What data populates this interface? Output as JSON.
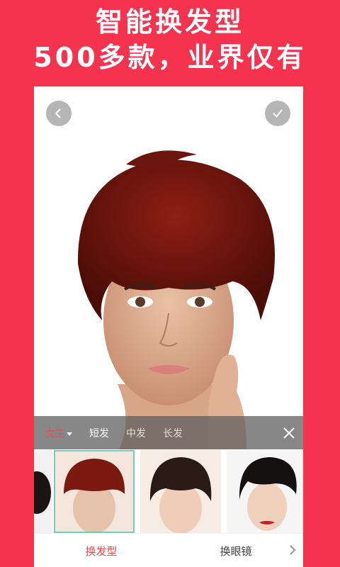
{
  "promo": {
    "line1": "智能换发型",
    "line2": "500多款，业界仅有"
  },
  "toolbar": {
    "back_icon": "chevron-left-icon",
    "confirm_icon": "check-icon"
  },
  "categories": {
    "gender": "女生",
    "items": [
      "短发",
      "中发",
      "长发"
    ],
    "close_icon": "close-icon"
  },
  "thumbnails": {
    "count": 4,
    "selected_index": 1
  },
  "bottom_nav": {
    "tabs": [
      "换发型",
      "换眼镜"
    ],
    "active": "换发型"
  },
  "colors": {
    "brand": "#f5334f",
    "active_text": "#f04a4a",
    "selected_outline": "#7ec8c4"
  }
}
